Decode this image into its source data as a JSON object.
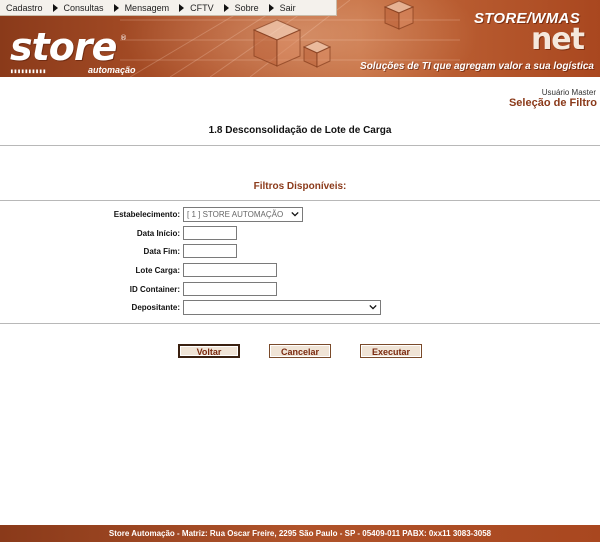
{
  "menu": {
    "items": [
      {
        "label": "Cadastro"
      },
      {
        "label": "Consultas"
      },
      {
        "label": "Mensagem"
      },
      {
        "label": "CFTV"
      },
      {
        "label": "Sobre"
      },
      {
        "label": "Sair"
      }
    ]
  },
  "header": {
    "logo_text": "store",
    "logo_subtext": "automação",
    "brand_top": "STORE/WMAS",
    "brand_net": "net",
    "tagline": "Soluções de TI que agregam valor a sua logística"
  },
  "user": {
    "name": "Usuário Master",
    "section": "Seleção de Filtro"
  },
  "page": {
    "title": "1.8 Desconsolidação de Lote de Carga"
  },
  "filters": {
    "title": "Filtros Disponíveis:",
    "estabelecimento_label": "Estabelecimento:",
    "estabelecimento_value": "[ 1 ] STORE AUTOMAÇÃO",
    "data_inicio_label": "Data Início:",
    "data_inicio_value": "",
    "data_fim_label": "Data Fim:",
    "data_fim_value": "",
    "lote_carga_label": "Lote Carga:",
    "lote_carga_value": "",
    "id_container_label": "ID Container:",
    "id_container_value": "",
    "depositante_label": "Depositante:",
    "depositante_value": ""
  },
  "buttons": {
    "voltar": "Voltar",
    "cancelar": "Cancelar",
    "executar": "Executar"
  },
  "footer": {
    "text": "Store Automação - Matriz: Rua Oscar Freire, 2295 São Paulo - SP - 05409-011 PABX: 0xx11 3083-3058"
  },
  "colors": {
    "brand": "#b0532a",
    "accent_text": "#8b3a1a",
    "button_bg": "#f0e4d6"
  }
}
